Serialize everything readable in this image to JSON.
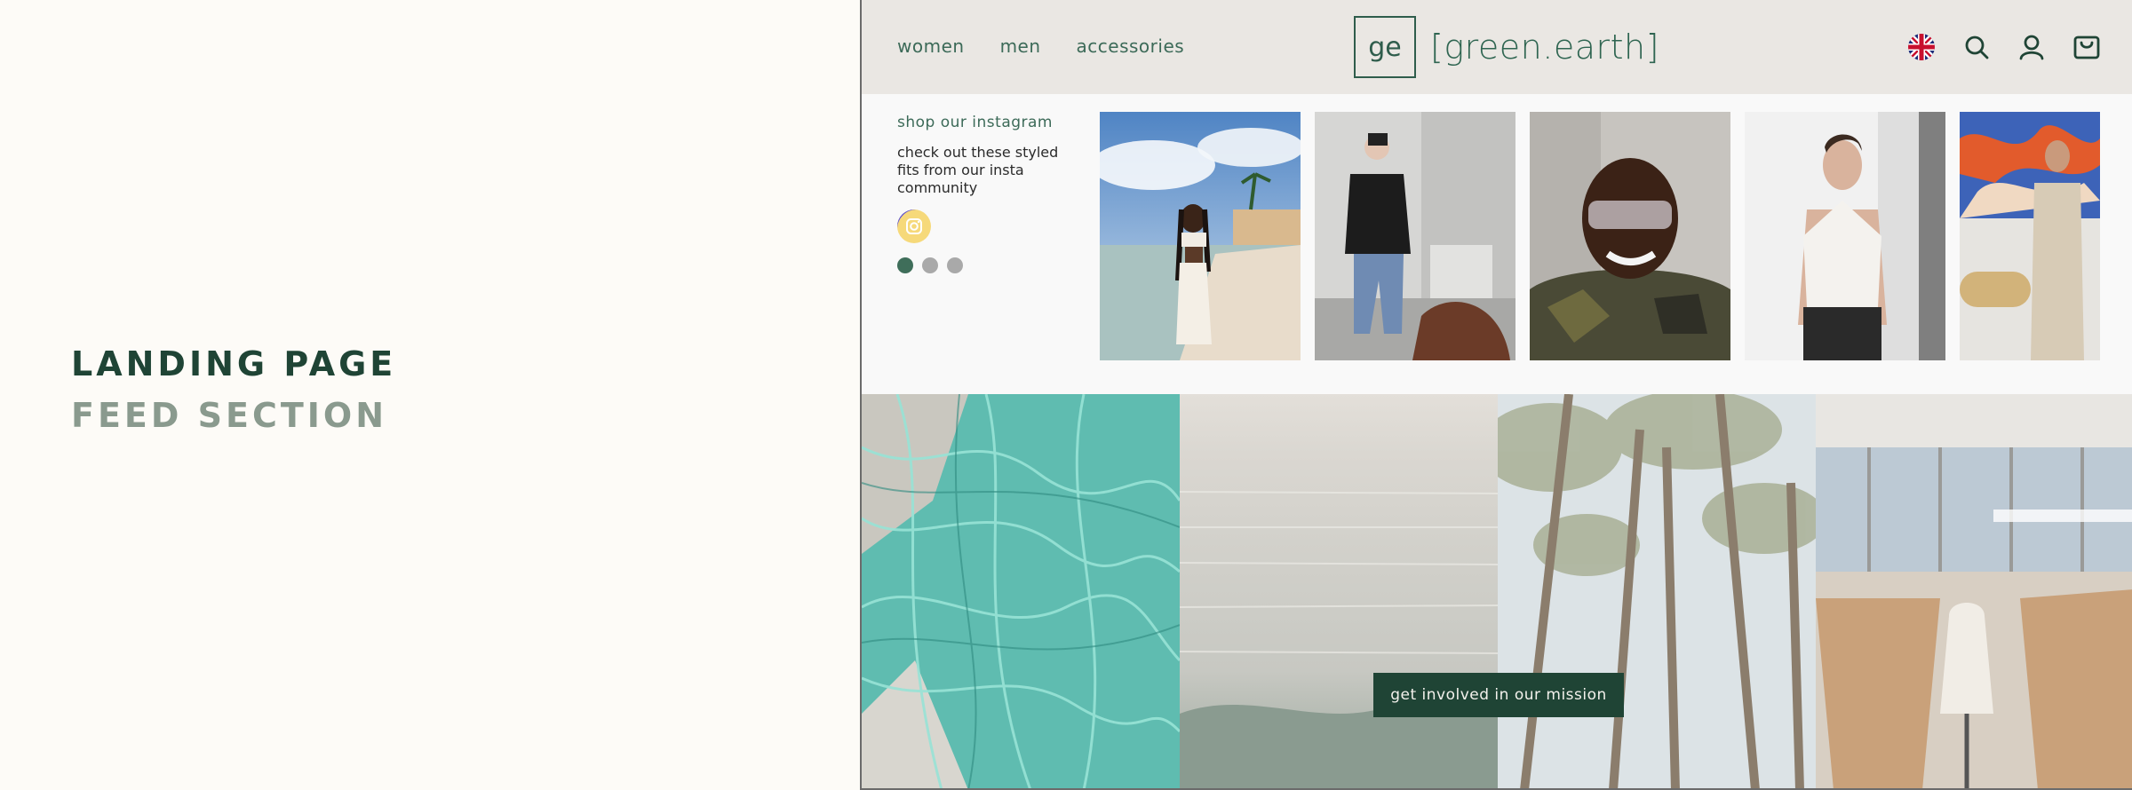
{
  "caption": {
    "line1": "LANDING PAGE",
    "line2": "FEED SECTION"
  },
  "header": {
    "nav": [
      "women",
      "men",
      "accessories"
    ],
    "logo_mark": "ge",
    "logo_text": "[green.earth]",
    "icons": [
      "uk-flag-icon",
      "search-icon",
      "user-icon",
      "shopping-bag-icon"
    ]
  },
  "instagram": {
    "title": "shop our instagram",
    "description": "check out these styled fits from our insta community",
    "icon": "instagram-icon",
    "pagination": {
      "total": 3,
      "active": 1
    },
    "photos": [
      "beach-photo",
      "mirror-selfie-photo",
      "sunglasses-selfie-photo",
      "halter-top-photo",
      "art-gallery-photo"
    ]
  },
  "mission": {
    "panels": [
      "fishing-net-photo",
      "ocean-photo",
      "forest-photo",
      "workshop-photo"
    ],
    "cta_label": "get involved in our mission"
  },
  "colors": {
    "brand_green": "#1f4435",
    "accent_green": "#3c6a58",
    "header_bg": "#eae7e3"
  }
}
